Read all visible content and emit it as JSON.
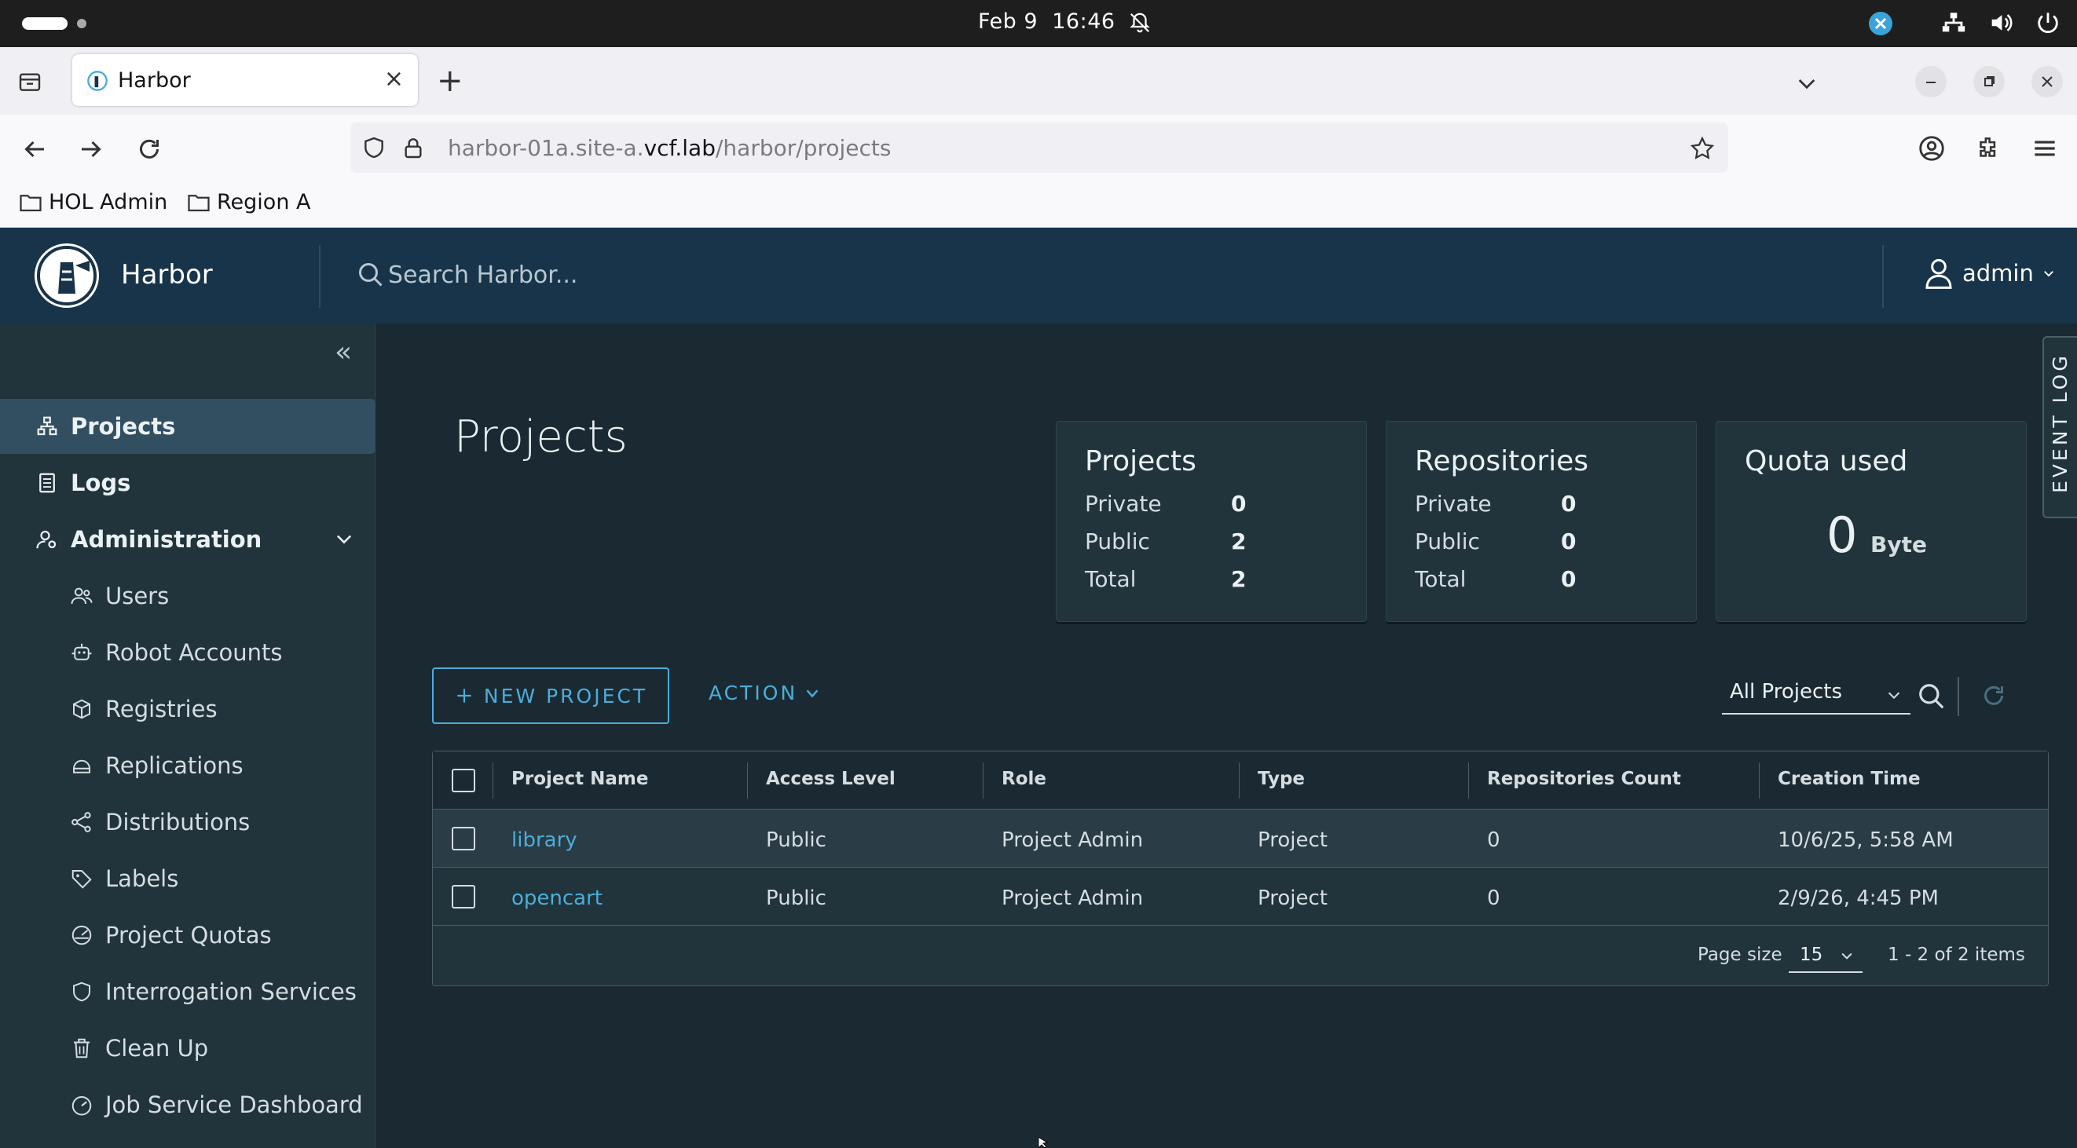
{
  "system": {
    "date": "Feb 9",
    "time": "16:46"
  },
  "browser": {
    "tab_title": "Harbor",
    "url_prefix": "harbor-01a.site-a.",
    "url_domain": "vcf.lab",
    "url_path": "/harbor/projects",
    "bookmarks": [
      "HOL Admin",
      "Region A"
    ]
  },
  "harbor": {
    "brand": "Harbor",
    "search_placeholder": "Search Harbor...",
    "user": "admin"
  },
  "sidebar": {
    "top_items": [
      {
        "label": "Projects",
        "icon": "projects-icon",
        "active": true
      },
      {
        "label": "Logs",
        "icon": "logs-icon"
      },
      {
        "label": "Administration",
        "icon": "administration-icon"
      }
    ],
    "admin_items": [
      {
        "label": "Users",
        "icon": "users-icon"
      },
      {
        "label": "Robot Accounts",
        "icon": "robot-icon"
      },
      {
        "label": "Registries",
        "icon": "registries-icon"
      },
      {
        "label": "Replications",
        "icon": "replications-icon"
      },
      {
        "label": "Distributions",
        "icon": "distributions-icon"
      },
      {
        "label": "Labels",
        "icon": "labels-icon"
      },
      {
        "label": "Project Quotas",
        "icon": "quotas-icon"
      },
      {
        "label": "Interrogation Services",
        "icon": "shield-icon"
      },
      {
        "label": "Clean Up",
        "icon": "trash-icon"
      },
      {
        "label": "Job Service Dashboard",
        "icon": "dashboard-icon"
      }
    ]
  },
  "main": {
    "title": "Projects",
    "cards": {
      "projects": {
        "title": "Projects",
        "rows": [
          [
            "Private",
            "0"
          ],
          [
            "Public",
            "2"
          ],
          [
            "Total",
            "2"
          ]
        ]
      },
      "repositories": {
        "title": "Repositories",
        "rows": [
          [
            "Private",
            "0"
          ],
          [
            "Public",
            "0"
          ],
          [
            "Total",
            "0"
          ]
        ]
      },
      "quota": {
        "title": "Quota used",
        "value": "0",
        "unit": "Byte"
      }
    },
    "new_project_label": "NEW PROJECT",
    "action_label": "ACTION",
    "filter_value": "All Projects",
    "event_log_label": "EVENT LOG"
  },
  "table": {
    "columns": [
      "Project Name",
      "Access Level",
      "Role",
      "Type",
      "Repositories Count",
      "Creation Time"
    ],
    "rows": [
      [
        "library",
        "Public",
        "Project Admin",
        "Project",
        "0",
        "10/6/25, 5:58 AM"
      ],
      [
        "opencart",
        "Public",
        "Project Admin",
        "Project",
        "0",
        "2/9/26, 4:45 PM"
      ]
    ],
    "page_size_label": "Page size",
    "page_size_value": "15",
    "count_label": "1 - 2 of 2 items"
  },
  "colors": {
    "header_bg": "#17344a",
    "sidebar_bg": "#21333b",
    "main_bg": "#1b2a32",
    "accent": "#4aaed9"
  }
}
